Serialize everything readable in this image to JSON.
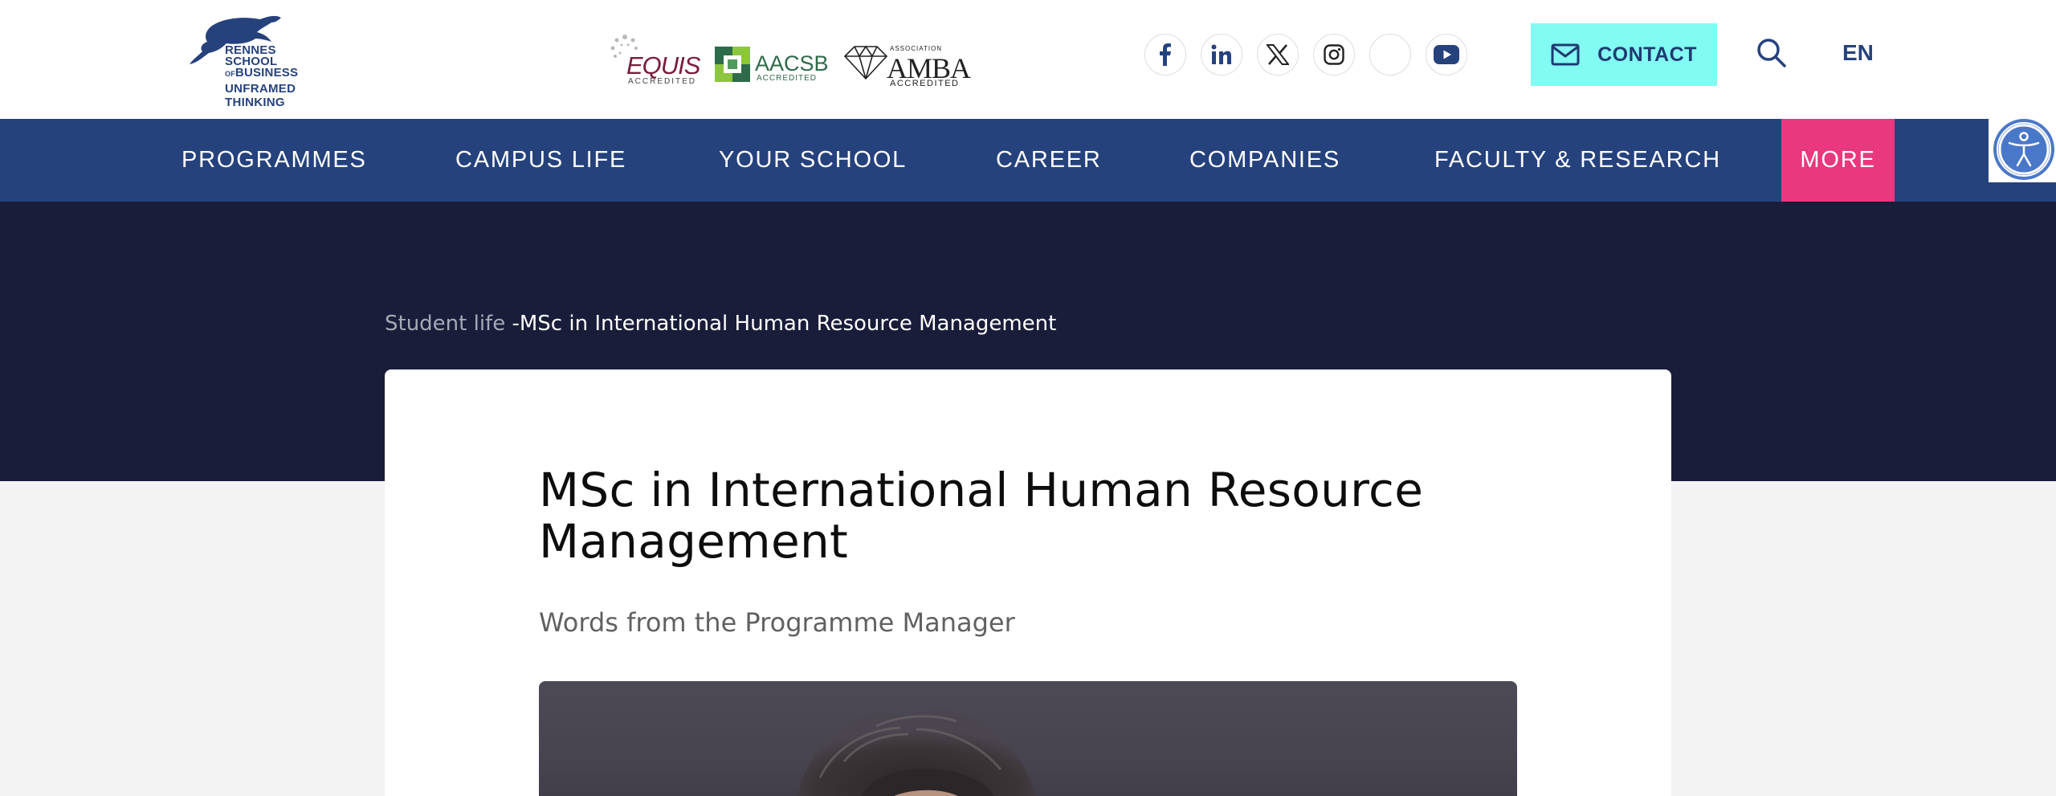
{
  "header": {
    "logo": {
      "name_lines": [
        "RENNES",
        "SCHOOL",
        "BUSINESS"
      ],
      "name_small": "OF",
      "tagline": "UNFRAMED THINKING"
    },
    "accreditations": {
      "equis": {
        "word": "EQUIS",
        "sub": "ACCREDITED"
      },
      "aacsb": {
        "word": "AACSB",
        "sub": "ACCREDITED"
      },
      "amba": {
        "assoc": "ASSOCIATION",
        "word": "AMBA",
        "sub": "ACCREDITED"
      }
    },
    "social_icons": [
      "facebook-icon",
      "linkedin-icon",
      "x-icon",
      "instagram-icon",
      "blank-social-icon",
      "youtube-icon"
    ],
    "contact_label": "CONTACT",
    "language": "EN"
  },
  "nav": {
    "items": [
      "PROGRAMMES",
      "CAMPUS LIFE",
      "YOUR SCHOOL",
      "CAREER",
      "COMPANIES",
      "FACULTY & RESEARCH"
    ],
    "more": "MORE"
  },
  "breadcrumb": {
    "parent": "Student life",
    "separator": " -",
    "current": "MSc in International Human Resource Management"
  },
  "article": {
    "title": "MSc in International Human Resource Management",
    "subtitle": "Words from the Programme Manager"
  },
  "colors": {
    "brand_blue": "#26427d",
    "hero_navy": "#191d3a",
    "contact_cyan": "#82fbf2",
    "more_pink": "#e9387d"
  }
}
